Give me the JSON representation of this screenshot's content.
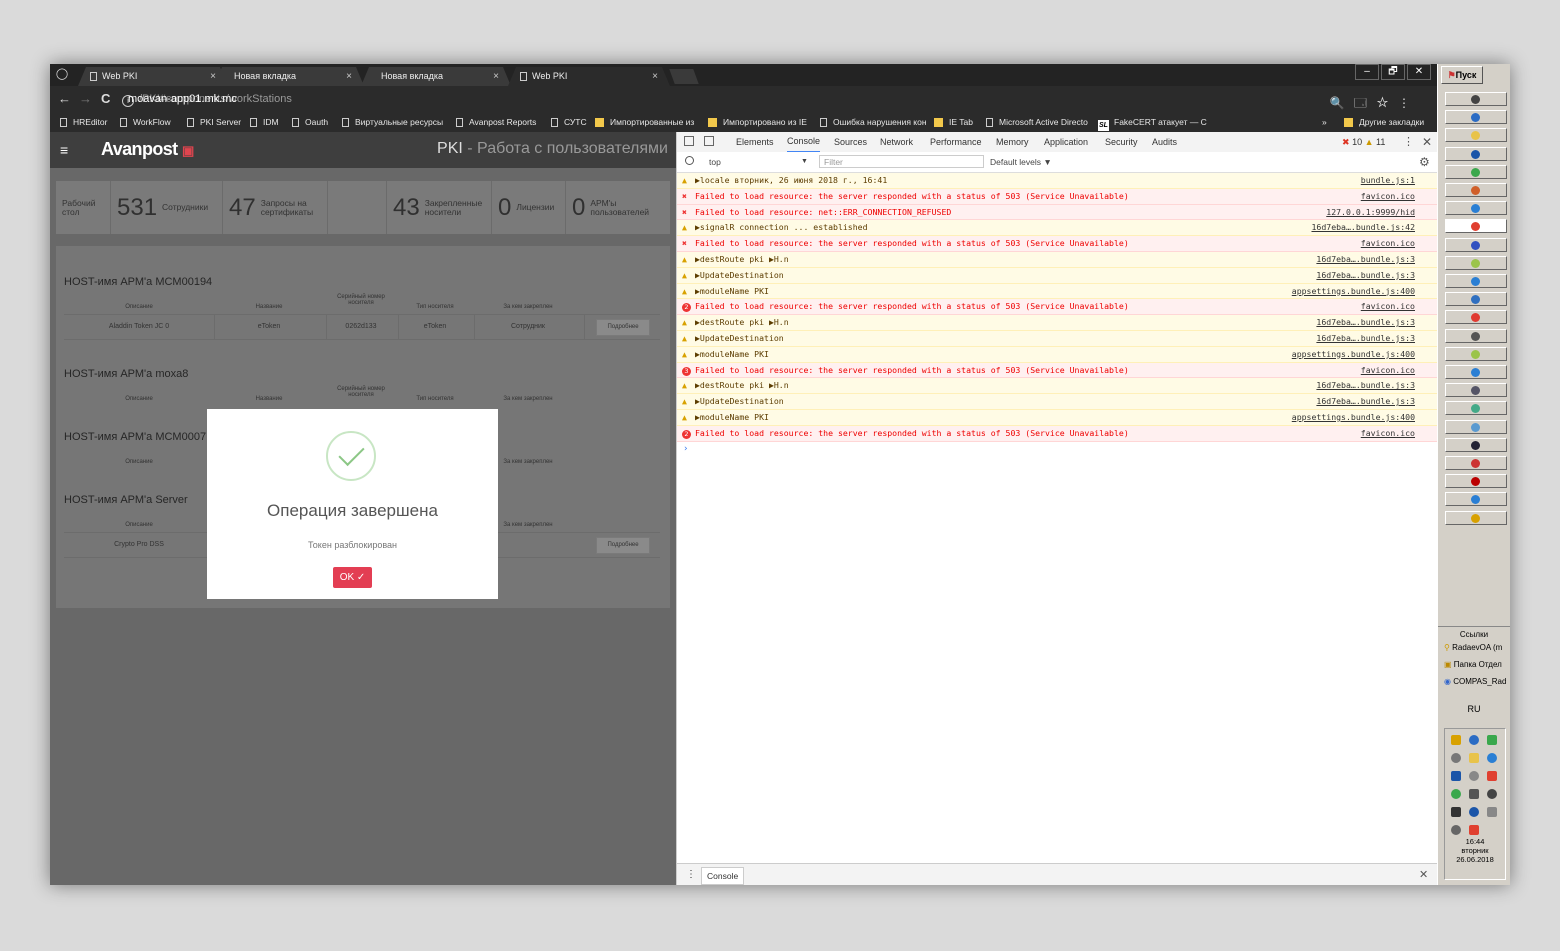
{
  "tabs": [
    {
      "label": "Web PKI",
      "close": "×"
    },
    {
      "label": "Новая вкладка",
      "close": "×"
    },
    {
      "label": "Новая вкладка",
      "close": "×"
    },
    {
      "label": "Web PKI",
      "close": "×"
    }
  ],
  "window_controls": [
    "–",
    "🗗",
    "✕"
  ],
  "address": {
    "back": "←",
    "forward": "→",
    "reload": "C",
    "host": "moavan-app01.mk.mc",
    "path": "/PKI#components/workStations",
    "icons": "🔍 🗔 ☆ ⋮"
  },
  "bookmarks": [
    {
      "label": "HREditor",
      "kind": "page"
    },
    {
      "label": "WorkFlow",
      "kind": "page"
    },
    {
      "label": "PKI Server",
      "kind": "page"
    },
    {
      "label": "IDM",
      "kind": "page"
    },
    {
      "label": "Oauth",
      "kind": "page"
    },
    {
      "label": "Виртуальные ресурсы",
      "kind": "page"
    },
    {
      "label": "Avanpost Reports",
      "kind": "page"
    },
    {
      "label": "СУТС",
      "kind": "page"
    },
    {
      "label": "Импортированные из",
      "kind": "folder"
    },
    {
      "label": "Импортировано из IE",
      "kind": "folder"
    },
    {
      "label": "Ошибка нарушения кон",
      "kind": "page"
    },
    {
      "label": "IE Tab",
      "kind": "folder"
    },
    {
      "label": "Microsoft Active Directo",
      "kind": "page"
    },
    {
      "label": "FakeCERT атакует — С",
      "kind": "sl"
    }
  ],
  "bookmarks_more": "»",
  "bookmarks_other": "Другие закладки",
  "app": {
    "menu_icon": "≡",
    "logo": "Avanpost",
    "title_main": "PKI",
    "title_sub": " - Работа с пользователями"
  },
  "stats": [
    {
      "num": "",
      "label": "Рабочий стол"
    },
    {
      "num": "531",
      "label": "Сотрудники"
    },
    {
      "num": "47",
      "label": "Запросы на сертификаты"
    },
    {
      "num": "",
      "label": ""
    },
    {
      "num": "43",
      "label": "Закрепленные носители"
    },
    {
      "num": "0",
      "label": "Лицензии"
    },
    {
      "num": "0",
      "label": "АРМ'ы пользователей"
    }
  ],
  "columns": {
    "desc": "Описание",
    "name": "Название",
    "serial": "Серийный номер носителя",
    "type": "Тип носителя",
    "owner": "За кем закреплен"
  },
  "hosts": [
    {
      "title": "HOST-имя АРМ'а MCM00194",
      "row": {
        "desc": "Aladdin Token JC 0",
        "name": "eToken",
        "serial": "0262d133",
        "type": "eToken",
        "owner": "Сотрудник",
        "button": "Подробнее"
      }
    },
    {
      "title": "HOST-имя АРМ'а moxa8"
    },
    {
      "title": "HOST-имя АРМ'а MCM0007"
    },
    {
      "title": "HOST-имя АРМ'а Server",
      "row": {
        "desc": "Crypto Pro DSS",
        "button": "Подробнее"
      }
    }
  ],
  "modal": {
    "title": "Операция завершена",
    "text": "Токен разблокирован",
    "ok": "OK ✓"
  },
  "devtools": {
    "tabs": [
      "Elements",
      "Console",
      "Sources",
      "Network",
      "Performance",
      "Memory",
      "Application",
      "Security",
      "Audits"
    ],
    "active_tab": "Console",
    "errors": "10",
    "warnings": "11",
    "context": "top",
    "filter_placeholder": "Filter",
    "levels": "Default levels ▼",
    "drawer_tab": "Console",
    "lines": [
      {
        "level": "warn",
        "msg": "▶locale вторник, 26 июня 2018 г., 16:41",
        "src": "bundle.js:1"
      },
      {
        "level": "err",
        "msg": "Failed to load resource: the server responded with a status of 503 (Service Unavailable)",
        "src": "favicon.ico"
      },
      {
        "level": "err",
        "msg": "Failed to load resource: net::ERR_CONNECTION_REFUSED",
        "src": "127.0.0.1:9999/hid"
      },
      {
        "level": "warn",
        "msg": "▶signalR connection ... established",
        "src": "16d7eba….bundle.js:42"
      },
      {
        "level": "err",
        "msg": "Failed to load resource: the server responded with a status of 503 (Service Unavailable)",
        "src": "favicon.ico"
      },
      {
        "level": "warn",
        "msg": "▶destRoute pki ▶H.n",
        "src": "16d7eba….bundle.js:3"
      },
      {
        "level": "warn",
        "msg": "▶UpdateDestination",
        "src": "16d7eba….bundle.js:3"
      },
      {
        "level": "warn",
        "msg": "▶moduleName PKI",
        "src": "appsettings.bundle.js:400"
      },
      {
        "level": "err",
        "badge": "2",
        "msg": "Failed to load resource: the server responded with a status of 503 (Service Unavailable)",
        "src": "favicon.ico"
      },
      {
        "level": "warn",
        "msg": "▶destRoute pki ▶H.n",
        "src": "16d7eba….bundle.js:3"
      },
      {
        "level": "warn",
        "msg": "▶UpdateDestination",
        "src": "16d7eba….bundle.js:3"
      },
      {
        "level": "warn",
        "msg": "▶moduleName PKI",
        "src": "appsettings.bundle.js:400"
      },
      {
        "level": "err",
        "badge": "3",
        "msg": "Failed to load resource: the server responded with a status of 503 (Service Unavailable)",
        "src": "favicon.ico"
      },
      {
        "level": "warn",
        "msg": "▶destRoute pki ▶H.n",
        "src": "16d7eba….bundle.js:3"
      },
      {
        "level": "warn",
        "msg": "▶UpdateDestination",
        "src": "16d7eba….bundle.js:3"
      },
      {
        "level": "warn",
        "msg": "▶moduleName PKI",
        "src": "appsettings.bundle.js:400"
      },
      {
        "level": "err",
        "badge": "2",
        "msg": "Failed to load resource: the server responded with a status of 503 (Service Unavailable)",
        "src": "favicon.ico"
      }
    ],
    "prompt": "›"
  },
  "taskbar": {
    "start": "Пуск",
    "links_header": "Ссылки",
    "links": [
      "RadaevOA (m",
      "Папка Отдел",
      "COMPAS_Rad"
    ],
    "lang": "RU",
    "time": "16:44",
    "weekday": "вторник",
    "date": "26.06.2018"
  }
}
